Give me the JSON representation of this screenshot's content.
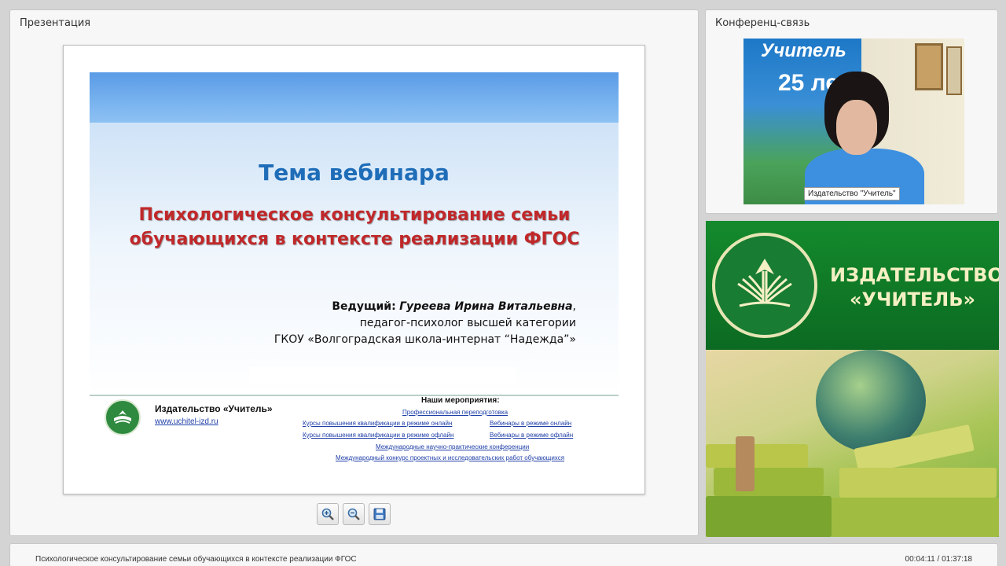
{
  "presentation": {
    "title": "Презентация",
    "slide": {
      "topic": "Тема вебинара",
      "title": "Психологическое консультирование семьи обучающихся в контексте реализации ФГОС",
      "presenter_label": "Ведущий:",
      "presenter_name": "Гуреева Ирина Витальевна",
      "presenter_position": "педагог-психолог высшей категории",
      "presenter_org": "ГКОУ «Волгоградская школа-интернат “Надежда”»",
      "publisher": "Издательство «Учитель»",
      "website": "www.uchitel-izd.ru",
      "events_heading": "Наши мероприятия:",
      "links": [
        "Профессиональная переподготовка",
        "Курсы повышения квалификации в режиме онлайн",
        "Вебинары в режиме онлайн",
        "Курсы повышения квалификации в режиме офлайн",
        "Вебинары в режиме офлайн",
        "Международные научно-практические конференции",
        "Международный конкурс проектных и исследовательских работ обучающихся"
      ]
    },
    "toolbar": {
      "zoom_in_icon": "zoom-in-icon",
      "zoom_out_icon": "zoom-out-icon",
      "save_icon": "save-icon"
    }
  },
  "conference": {
    "title": "Конференц-связь",
    "video_banner_line1": "Учитель",
    "video_banner_line2": "25 лет",
    "video_label": "Издательство \"Учитель\""
  },
  "brand": {
    "name_line1": "ИЗДАТЕЛЬСТВО",
    "name_line2": "«УЧИТЕЛЬ»"
  },
  "status": {
    "title": "Психологическое консультирование семьи обучающихся в контексте реализации ФГОС",
    "elapsed": "00:04:11",
    "total": "01:37:18",
    "time_display": "00:04:11 / 01:37:18"
  },
  "colors": {
    "slide_topic": "#1f6db8",
    "slide_title": "#c0282a",
    "brand_green": "#148a2c",
    "link_blue": "#1f3fa8"
  }
}
